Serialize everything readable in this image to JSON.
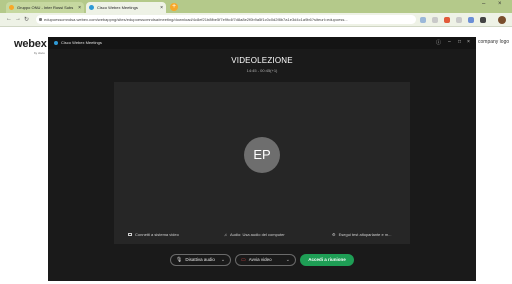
{
  "browser": {
    "tabs": [
      {
        "label": "Gruppo ONU - Inter Rossi Subs",
        "favicon_color": "#f7a829"
      },
      {
        "label": "Cisco Webex Meetings",
        "favicon_color": "#2f9ad6"
      }
    ],
    "new_tab_label": "+",
    "window_controls": {
      "minimize": "–",
      "close": "×"
    },
    "url": "edupoesscmndsa.webex.com/webappng/sites/edupoesscmndsa/meeting/download/4c8ef21b8fbe5f7e9fc4f7d8a8e2f0b9a5f1c0c0d2f8b7a1e3d4c1a9b6?siteurl=edupoess...",
    "colors": {
      "tabstrip": "#b4c98a",
      "toolbar": "#eef2e6"
    }
  },
  "page": {
    "brand": "webex",
    "brand_sub": "by cisco",
    "side_text": "company logo"
  },
  "meeting": {
    "app_title": "Cisco Webex Meetings",
    "room_name": "VIDEOLEZIONE",
    "time": "14:45 - 00:45(+1)",
    "avatar_initials": "EP",
    "options": {
      "video_system": "Connetti a sistema video",
      "audio": "Audio: Usa audio del computer",
      "speaker": "Esegui test altoparlante e m..."
    },
    "buttons": {
      "mute": "Disattiva audio",
      "video": "Avvia video",
      "join": "Accedi a riunione"
    },
    "colors": {
      "join": "#1e9e55",
      "background": "#1a1a1a",
      "stage": "#262626"
    }
  }
}
